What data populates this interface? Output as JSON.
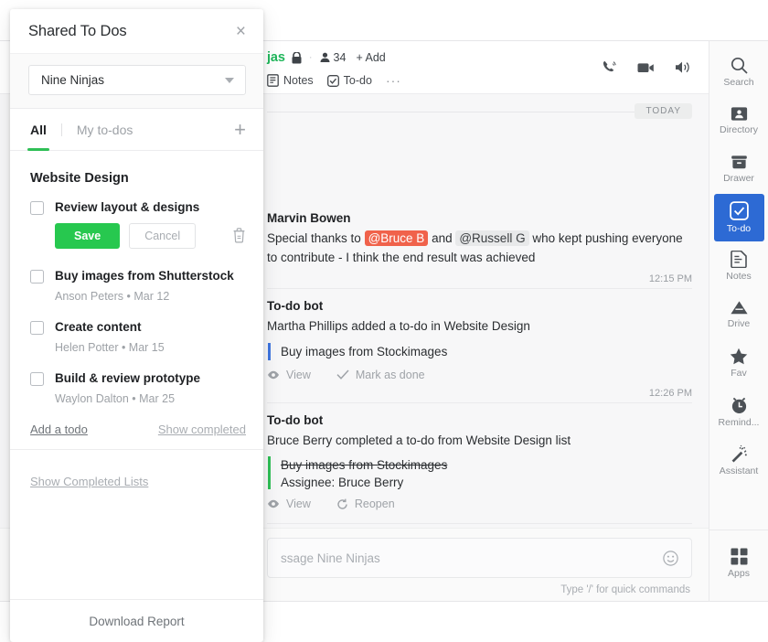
{
  "panel": {
    "title": "Shared To Dos",
    "close_label": "×",
    "select_value": "Nine Ninjas",
    "tabs": [
      {
        "label": "All",
        "active": true
      },
      {
        "label": "My to-dos",
        "active": false
      }
    ],
    "add_button": "+",
    "list_title": "Website Design",
    "todos": [
      {
        "text": "Review layout & designs",
        "editing": true,
        "save_label": "Save",
        "cancel_label": "Cancel",
        "meta": ""
      },
      {
        "text": "Buy images from Shutterstock",
        "editing": false,
        "meta": "Anson Peters  •  Mar 12"
      },
      {
        "text": "Create content",
        "editing": false,
        "meta": "Helen Potter  •  Mar 15"
      },
      {
        "text": "Build & review prototype",
        "editing": false,
        "meta": "Waylon Dalton  •  Mar 25"
      }
    ],
    "add_todo_label": "Add a todo",
    "show_completed_label": "Show completed",
    "show_completed_lists_label": "Show Completed Lists",
    "download_report_label": "Download Report"
  },
  "chat": {
    "channel_name": "jas",
    "member_count": "34",
    "add_label": "+ Add",
    "tabs": [
      {
        "label": "Notes",
        "icon": "notes-icon"
      },
      {
        "label": "To-do",
        "icon": "todo-check-icon"
      }
    ],
    "more_label": "···",
    "date_divider": "TODAY",
    "messages": [
      {
        "author": "Marvin Bowen",
        "body_pre": "Special thanks to ",
        "mention1": "@Bruce B",
        "body_mid": " and ",
        "mention2": "@Russell G",
        "body_post": " who kept pushing everyone to contribute - I think the end result was achieved",
        "time": "12:15 PM"
      },
      {
        "author": "To-do bot",
        "body": "Martha Phillips added a to-do in Website Design",
        "card_title": "Buy images from Stockimages",
        "card_accent": "#3f76e0",
        "actions": [
          "View",
          "Mark as done"
        ],
        "time": "12:26 PM"
      },
      {
        "author": "To-do bot",
        "body": "Bruce Berry completed a to-do from Website Design list",
        "card_title": "Buy images from Stockimages",
        "card_assignee": "Assignee: Bruce Berry",
        "card_accent": "#2fbf56",
        "actions": [
          "View",
          "Reopen"
        ],
        "time": ""
      }
    ],
    "composer_placeholder": "ssage Nine Ninjas",
    "composer_value": "",
    "composer_hint": "Type '/' for quick commands"
  },
  "rail": {
    "items": [
      {
        "label": "Search",
        "icon": "search-icon",
        "active": false
      },
      {
        "label": "Directory",
        "icon": "directory-icon",
        "active": false
      },
      {
        "label": "Drawer",
        "icon": "drawer-icon",
        "active": false
      },
      {
        "label": "To-do",
        "icon": "todo-check-icon",
        "active": true
      },
      {
        "label": "Notes",
        "icon": "notes-icon",
        "active": false
      },
      {
        "label": "Drive",
        "icon": "drive-icon",
        "active": false
      },
      {
        "label": "Fav",
        "icon": "star-icon",
        "active": false
      },
      {
        "label": "Remind...",
        "icon": "clock-icon",
        "active": false
      },
      {
        "label": "Assistant",
        "icon": "wand-icon",
        "active": false
      }
    ],
    "apps": {
      "label": "Apps",
      "icon": "grid-icon"
    }
  },
  "colors": {
    "accent_green": "#2fbf56",
    "save_green": "#27c84f",
    "rail_active_blue": "#2d6ad4",
    "mention_red": "#f0624b",
    "card_blue": "#3f76e0"
  }
}
